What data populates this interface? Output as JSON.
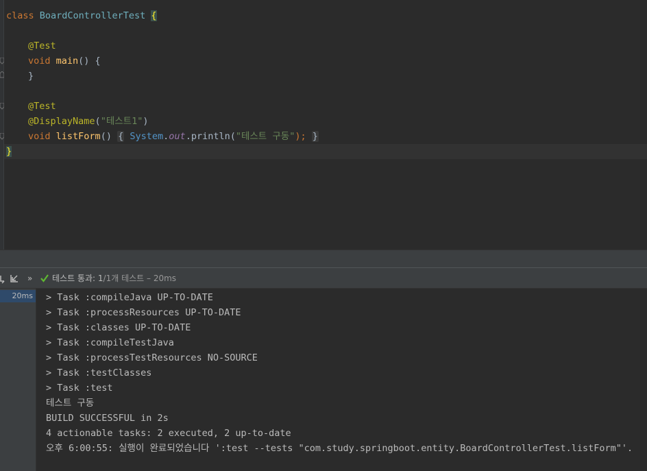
{
  "editor": {
    "lines": [
      {
        "t": [
          "class",
          " ",
          "BoardControllerTest",
          " ",
          "{"
        ]
      },
      {
        "annotation1": "@Test"
      },
      {
        "void": "void",
        "name": "main",
        "rest": "() {"
      },
      {
        "close": "}"
      },
      {
        "annotation2": "@Test"
      },
      {
        "annotation3": "@DisplayName",
        "arg": "\"테스트1\"",
        "paren_open": "(",
        "paren_close": ")"
      },
      {
        "void": "void",
        "name": "listForm",
        "parens": "()",
        "brace_open": "{",
        "system": "System",
        "dot1": ".",
        "out": "out",
        "dot2": ".println(",
        "str": "\"테스트 구동\"",
        "end": ");",
        "brace_close": "}"
      },
      {
        "close": "}"
      }
    ],
    "class_kw": "class",
    "class_name": "BoardControllerTest",
    "class_open": "{",
    "test_annotation": "@Test",
    "main_void": "void",
    "main_name": "main",
    "main_rest": "() {",
    "main_close": "}",
    "test_annotation2": "@Test",
    "display_name_ann": "@DisplayName",
    "display_name_open": "(",
    "display_name_arg": "\"테스트1\"",
    "display_name_close": ")",
    "listform_void": "void",
    "listform_name": "listForm",
    "listform_parens": "()",
    "listform_brace_open": "{",
    "system": "System",
    "dot": ".",
    "out": "out",
    "println": ".println(",
    "println_arg": "\"테스트 구동\"",
    "println_end": ");",
    "listform_brace_close": "}",
    "class_close": "}"
  },
  "run_toolbar": {
    "more_chevron": "»",
    "status_label": "테스트 통과:",
    "status_count": "1",
    "status_detail": "/1개 테스트 – 20ms"
  },
  "test_tree": {
    "selected_time": "20ms"
  },
  "console": {
    "lines": [
      "> Task :compileJava UP-TO-DATE",
      "> Task :processResources UP-TO-DATE",
      "> Task :classes UP-TO-DATE",
      "> Task :compileTestJava",
      "> Task :processTestResources NO-SOURCE",
      "> Task :testClasses",
      "> Task :test",
      "테스트 구동",
      "BUILD SUCCESSFUL in 2s",
      "4 actionable tasks: 2 executed, 2 up-to-date",
      "오후 6:00:55: 실행이 완료되었습니다 ':test --tests \"com.study.springboot.entity.BoardControllerTest.listForm\"'."
    ]
  },
  "colors": {
    "keyword": "#cc7832",
    "annotation": "#bbb529",
    "function": "#ffc66d",
    "string": "#6a8759",
    "success": "#5fb832"
  },
  "icons": [
    "rerun-failed-icon",
    "collapse-icon",
    "more-chevron-icon",
    "check-icon"
  ]
}
